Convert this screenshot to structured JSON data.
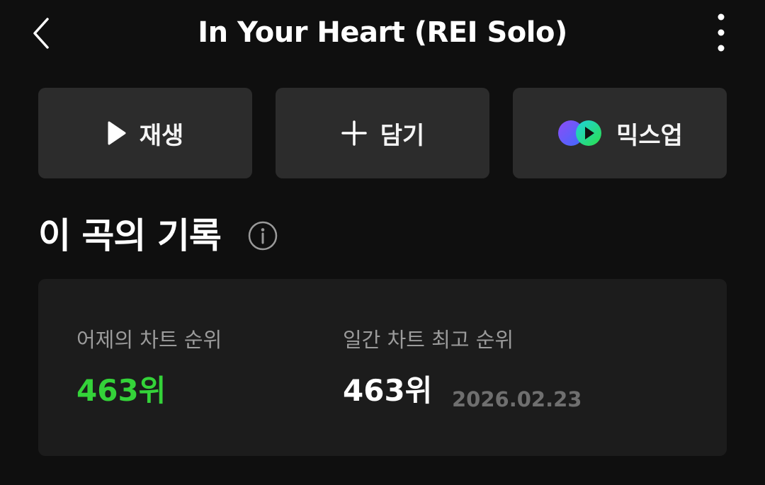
{
  "header": {
    "title": "In Your Heart (REI Solo)",
    "back_icon": "chevron-left-icon",
    "more_icon": "more-vertical-icon"
  },
  "actions": [
    {
      "label": "재생",
      "icon": "play-icon"
    },
    {
      "label": "담기",
      "icon": "plus-icon"
    },
    {
      "label": "믹스업",
      "icon": "mixup-logo-icon"
    }
  ],
  "record": {
    "title": "이 곡의 기록",
    "info_icon": "info-icon",
    "yesterday": {
      "label": "어제의 차트 순위",
      "value": "463위",
      "color": "#34d339"
    },
    "peak": {
      "label": "일간 차트 최고 순위",
      "value": "463위",
      "date": "2026.02.23"
    }
  },
  "colors": {
    "background": "#0f0f0f",
    "button": "#2c2c2c",
    "card": "#1c1c1c",
    "accent_green": "#34d339"
  }
}
